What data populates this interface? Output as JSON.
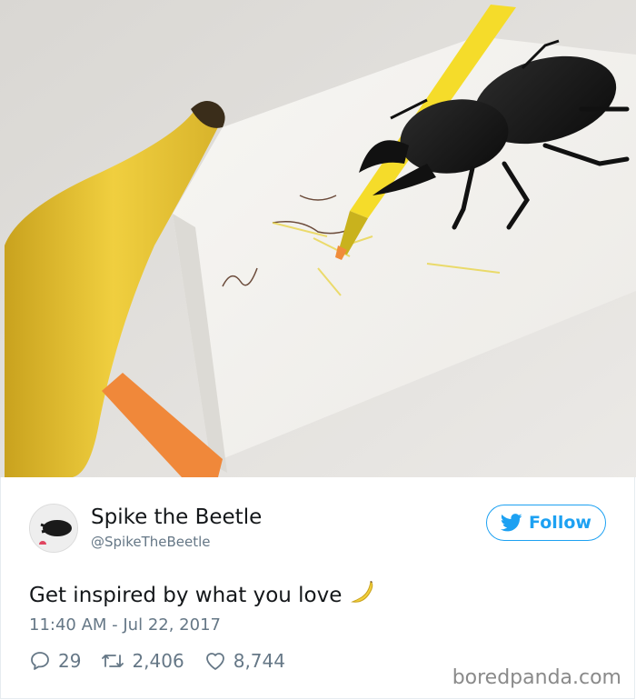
{
  "photo": {
    "description_icon": "beetle-drawing-photo"
  },
  "tweet": {
    "display_name": "Spike the Beetle",
    "handle": "@SpikeTheBeetle",
    "follow_label": "Follow",
    "text": "Get inspired by what you love",
    "emoji": "🍌",
    "timestamp": "11:40 AM - Jul 22, 2017",
    "replies": "29",
    "retweets": "2,406",
    "likes": "8,744"
  },
  "watermark": "boredpanda.com",
  "colors": {
    "twitter_blue": "#1da1f2",
    "meta_gray": "#657786",
    "text": "#14171a"
  }
}
